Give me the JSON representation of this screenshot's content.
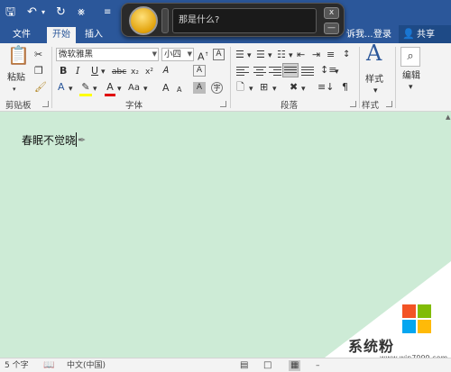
{
  "quick_access": {
    "save_icon": "save-icon",
    "undo_icon": "undo-icon",
    "redo_icon": "redo-icon",
    "touch_icon": "touch-mode-icon",
    "more_icon": "customize-icon"
  },
  "tabs": [
    "文件",
    "开始",
    "插入"
  ],
  "active_tab": "开始",
  "tell_me_fragment": "诉我...",
  "right_tabs": {
    "login": "登录",
    "share": "共享"
  },
  "ribbon": {
    "clipboard": {
      "label": "剪贴板",
      "paste": "粘贴"
    },
    "font": {
      "label": "字体",
      "font_name": "微软雅黑",
      "font_size": "小四",
      "buttons": [
        "B",
        "I",
        "U",
        "abc",
        "x₂",
        "x²",
        "A",
        "A",
        "Aa",
        "A",
        "A",
        "A",
        "A",
        "wén",
        "字"
      ]
    },
    "paragraph": {
      "label": "段落"
    },
    "styles": {
      "label": "样式",
      "button": "样式"
    },
    "editing": {
      "label": "",
      "button": "编辑"
    }
  },
  "voice_bar": {
    "prompt": "那是什么?",
    "close": "x",
    "minimize": "—"
  },
  "document": {
    "text": "春眠不觉晓"
  },
  "status": {
    "word_count": "5 个字",
    "language": "中文(中国)"
  },
  "watermark": {
    "name": "系统粉",
    "url": "www.win7999.com",
    "logo_colors": [
      "#f35325",
      "#81bc06",
      "#05a6f0",
      "#ffba08"
    ]
  },
  "colors": {
    "title_blue": "#2b579a",
    "doc_background": "#cdebd6",
    "ribbon_bg": "#f3f3f3"
  }
}
